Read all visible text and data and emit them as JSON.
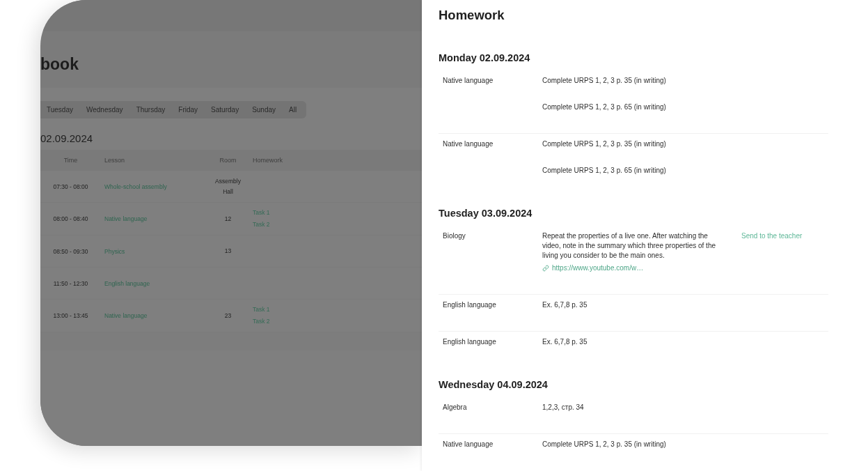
{
  "background_page": {
    "title": "book",
    "day_tabs": [
      {
        "label": "Tuesday",
        "selected": false
      },
      {
        "label": "Wednesday",
        "selected": false
      },
      {
        "label": "Thursday",
        "selected": false
      },
      {
        "label": "Friday",
        "selected": false
      },
      {
        "label": "Saturday",
        "selected": false
      },
      {
        "label": "Sunday",
        "selected": false
      },
      {
        "label": "All",
        "selected": false
      }
    ],
    "date_heading": "02.09.2024",
    "schedule": {
      "columns": [
        "Time",
        "Lesson",
        "Room",
        "Homework"
      ],
      "rows": [
        {
          "time": "07:30 - 08:00",
          "lesson": "Whole-school assembly",
          "room": "Assembly Hall"
        },
        {
          "time": "08:00 - 08:40",
          "lesson": "Native language",
          "room": "12",
          "homework": [
            "Task 1",
            "Task 2"
          ]
        },
        {
          "time": "08:50 - 09:30",
          "lesson": "Physics",
          "room": "13"
        },
        {
          "time": "11:50 - 12:30",
          "lesson": "English language"
        },
        {
          "time": "13:00 - 13:45",
          "lesson": "Native language",
          "room": "23",
          "homework": [
            "Task 1",
            "Task 2"
          ]
        }
      ]
    }
  },
  "homework_panel": {
    "title": "Homework",
    "days": [
      {
        "heading": "Monday 02.09.2024",
        "entries": [
          {
            "subject": "Native language",
            "tasks": [
              "Complete URPS 1, 2, 3 p. 35 (in writing)",
              "Complete URPS 1, 2, 3 p. 65 (in writing)"
            ]
          },
          {
            "subject": "Native language",
            "tasks": [
              "Complete URPS 1, 2, 3 p. 35 (in writing)",
              "Complete URPS 1, 2, 3 p. 65 (in writing)"
            ]
          }
        ]
      },
      {
        "heading": "Tuesday 03.09.2024",
        "entries": [
          {
            "subject": "Biology",
            "tasks": [
              "Repeat the properties of a live one. After watching the video, note in the summary which three properties of the living you consider to be the main ones."
            ],
            "link": "https://www.youtube.com/w…",
            "action": "Send to the teacher"
          },
          {
            "subject": "English language",
            "tasks": [
              "Ex. 6,7,8 p. 35"
            ]
          },
          {
            "subject": "English language",
            "tasks": [
              "Ex. 6,7,8 p. 35"
            ]
          }
        ]
      },
      {
        "heading": "Wednesday 04.09.2024",
        "entries": [
          {
            "subject": "Algebra",
            "tasks": [
              "1,2,3, стр. 34"
            ]
          },
          {
            "subject": "Native language",
            "tasks": [
              "Complete URPS 1, 2, 3 p. 35 (in writing)"
            ]
          }
        ]
      }
    ]
  }
}
